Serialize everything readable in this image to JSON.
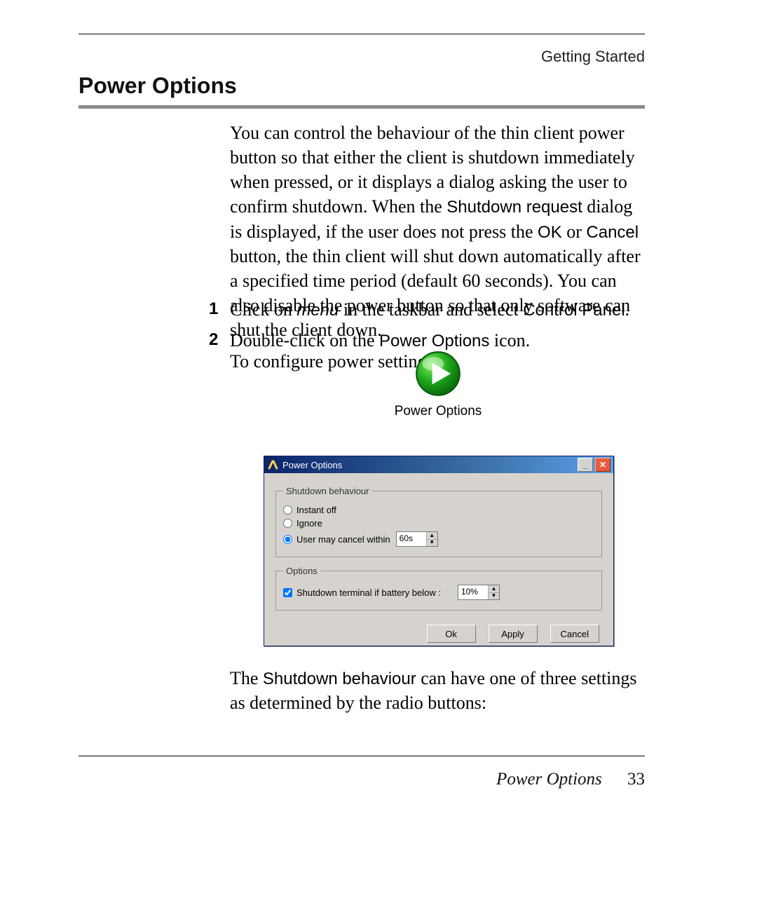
{
  "header": {
    "running_head": "Getting Started"
  },
  "heading": "Power Options",
  "intro": {
    "p1_a": "You can control the behaviour of the thin client power button so that either the client is shutdown immediately when pressed, or it displays a dialog asking the user to confirm shutdown. When the ",
    "sd_request": "Shutdown request",
    "p1_b": " dialog is displayed, if the user does not press the ",
    "ok": "OK",
    "p1_c": " or ",
    "cancel": "Cancel",
    "p1_d": " button, the thin client will shut down automatically after a specified time period (default 60 seconds). You can also disable the power button so that only software can shut the client down.",
    "p2": "To configure power settings:"
  },
  "steps": {
    "s1": {
      "num": "1",
      "a": "Click on ",
      "menu": "menu",
      "b": " in the taskbar and select ",
      "cp": "Control Panel",
      "c": "."
    },
    "s2": {
      "num": "2",
      "a": "Double-click on the ",
      "po": "Power Options",
      "b": " icon."
    }
  },
  "icon": {
    "label": "Power Options"
  },
  "dialog": {
    "title": "Power Options",
    "group1": {
      "legend": "Shutdown behaviour",
      "opt_instant": "Instant off",
      "opt_ignore": "Ignore",
      "opt_cancel": "User may cancel within",
      "cancel_value": "60s",
      "selected": "cancel"
    },
    "group2": {
      "legend": "Options",
      "chk_label": "Shutdown terminal if battery below :",
      "chk_value": "10%",
      "checked": true
    },
    "buttons": {
      "ok": "Ok",
      "apply": "Apply",
      "cancel": "Cancel"
    }
  },
  "after": {
    "a": "The ",
    "sb": "Shutdown behaviour",
    "b": " can have one of three settings as determined by the radio buttons:"
  },
  "footer": {
    "section": "Power Options",
    "page": "33"
  }
}
